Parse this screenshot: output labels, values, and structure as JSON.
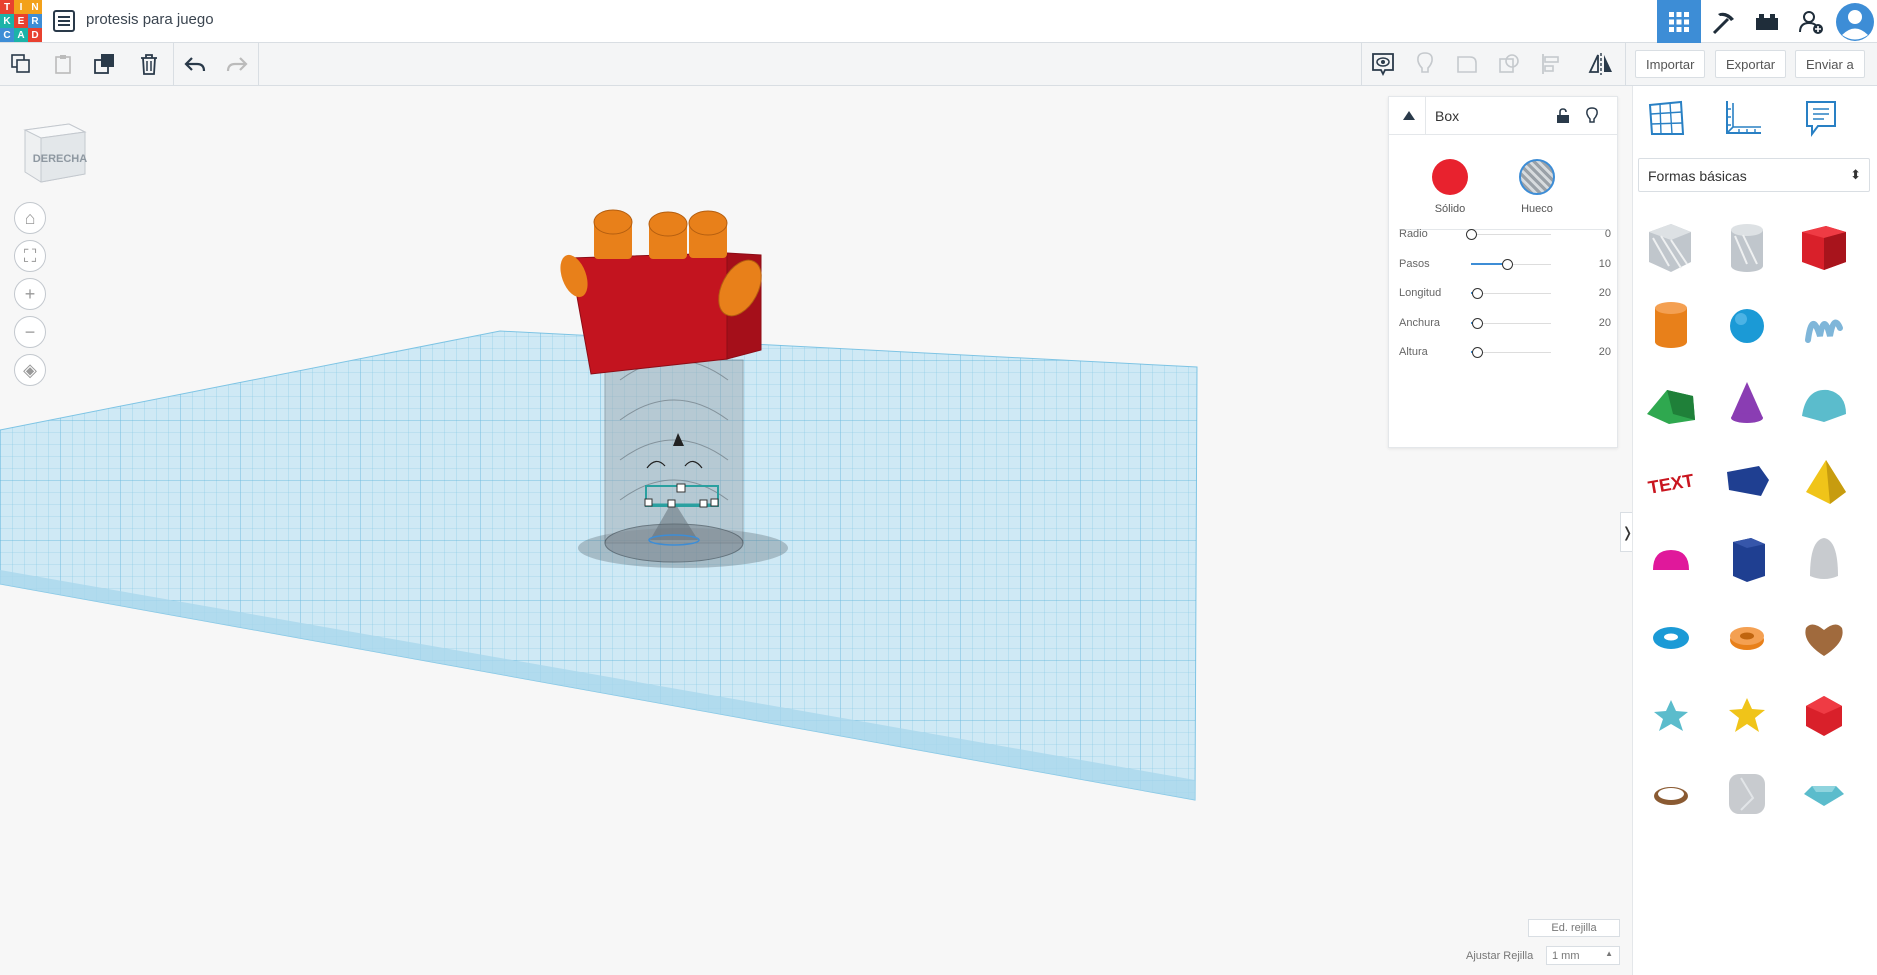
{
  "app": {
    "logo_letters": [
      "T",
      "I",
      "N",
      "K",
      "E",
      "R",
      "C",
      "A",
      "D"
    ],
    "logo_colors": [
      "#e8412f",
      "#f3a11a",
      "#f3a11a",
      "#1bb3a8",
      "#e8412f",
      "#3d8dd6",
      "#3d8dd6",
      "#1bb3a8",
      "#e8412f"
    ],
    "doc_title": "protesis para juego"
  },
  "topbar": {
    "icons": [
      "grid-view-icon",
      "pickaxe-icon",
      "bricks-icon",
      "add-user-icon",
      "user-avatar-icon"
    ]
  },
  "toolbar": {
    "import_label": "Importar",
    "export_label": "Exportar",
    "send_label": "Enviar a"
  },
  "viewcube": {
    "label": "DERECHA"
  },
  "inspector": {
    "title": "Box",
    "solid_label": "Sólido",
    "hole_label": "Hueco",
    "solid_color": "#e8222e",
    "props": [
      {
        "label": "Radio",
        "value": "0",
        "fraction": 0.0
      },
      {
        "label": "Pasos",
        "value": "10",
        "fraction": 0.45
      },
      {
        "label": "Longitud",
        "value": "20",
        "fraction": 0.08
      },
      {
        "label": "Anchura",
        "value": "20",
        "fraction": 0.08
      },
      {
        "label": "Altura",
        "value": "20",
        "fraction": 0.08
      }
    ]
  },
  "bottom": {
    "edit_grid_label": "Ed. rejilla",
    "snap_label": "Ajustar Rejilla",
    "snap_value": "1 mm"
  },
  "shapes_panel": {
    "library_label": "Formas básicas",
    "tabs": [
      "workplane-grid-icon",
      "ruler-icon",
      "notes-icon"
    ],
    "shapes": [
      {
        "name": "box-hole",
        "color": "#c0c6cc"
      },
      {
        "name": "cylinder-hole",
        "color": "#c0c6cc"
      },
      {
        "name": "box",
        "color": "#d9202a"
      },
      {
        "name": "cylinder",
        "color": "#e8801a"
      },
      {
        "name": "sphere",
        "color": "#1b9ad6"
      },
      {
        "name": "scribble",
        "color": "#7fb6d9"
      },
      {
        "name": "roof",
        "color": "#2fa84f"
      },
      {
        "name": "cone",
        "color": "#8a3db3"
      },
      {
        "name": "round-roof",
        "color": "#5bbccc"
      },
      {
        "name": "text",
        "color": "#c9151f"
      },
      {
        "name": "polygon",
        "color": "#1f3f91"
      },
      {
        "name": "pyramid",
        "color": "#f0c419"
      },
      {
        "name": "half-sphere",
        "color": "#e0189b"
      },
      {
        "name": "hexagonal-prism",
        "color": "#1f3f91"
      },
      {
        "name": "paraboloid",
        "color": "#c8cbcf"
      },
      {
        "name": "torus",
        "color": "#1b9ad6"
      },
      {
        "name": "tube",
        "color": "#e8801a"
      },
      {
        "name": "heart",
        "color": "#a06a3d"
      },
      {
        "name": "star",
        "color": "#5bbccc"
      },
      {
        "name": "star-gold",
        "color": "#f0c419"
      },
      {
        "name": "icosahedron",
        "color": "#d9202a"
      },
      {
        "name": "ring",
        "color": "#8a5a32"
      },
      {
        "name": "rounded-box",
        "color": "#c8cbcf"
      },
      {
        "name": "diamond",
        "color": "#5bbccc"
      }
    ]
  }
}
